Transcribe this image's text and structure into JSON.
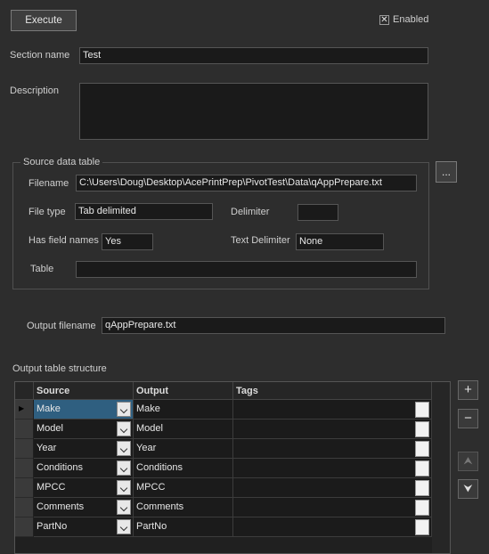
{
  "toolbar": {
    "execute_label": "Execute",
    "enabled_label": "Enabled",
    "enabled_checked": true,
    "check_mark": "✕"
  },
  "section": {
    "name_label": "Section name",
    "name_value": "Test",
    "description_label": "Description",
    "description_value": ""
  },
  "source": {
    "group_title": "Source data table",
    "filename_label": "Filename",
    "filename_value": "C:\\Users\\Doug\\Desktop\\AcePrintPrep\\PivotTest\\Data\\qAppPrepare.txt",
    "browse_label": "...",
    "filetype_label": "File type",
    "filetype_value": "Tab delimited",
    "delimiter_label": "Delimiter",
    "delimiter_value": "",
    "hasfield_label": "Has field names",
    "hasfield_value": "Yes",
    "textdelim_label": "Text Delimiter",
    "textdelim_value": "None",
    "table_label": "Table",
    "table_value": ""
  },
  "output": {
    "filename_label": "Output filename",
    "filename_value": "qAppPrepare.txt"
  },
  "structure": {
    "title": "Output table structure",
    "columns": [
      "Source",
      "Output",
      "Tags"
    ],
    "rows": [
      {
        "source": "Make",
        "output": "Make",
        "tags": ""
      },
      {
        "source": "Model",
        "output": "Model",
        "tags": ""
      },
      {
        "source": "Year",
        "output": "Year",
        "tags": ""
      },
      {
        "source": "Conditions",
        "output": "Conditions",
        "tags": ""
      },
      {
        "source": "MPCC",
        "output": "MPCC",
        "tags": ""
      },
      {
        "source": "Comments",
        "output": "Comments",
        "tags": ""
      },
      {
        "source": "PartNo",
        "output": "PartNo",
        "tags": ""
      }
    ],
    "selected_row": 0,
    "row_indicator": "▶"
  },
  "side_buttons": {
    "add": "+",
    "remove": "−",
    "up": "⮝",
    "down": "⮟"
  }
}
